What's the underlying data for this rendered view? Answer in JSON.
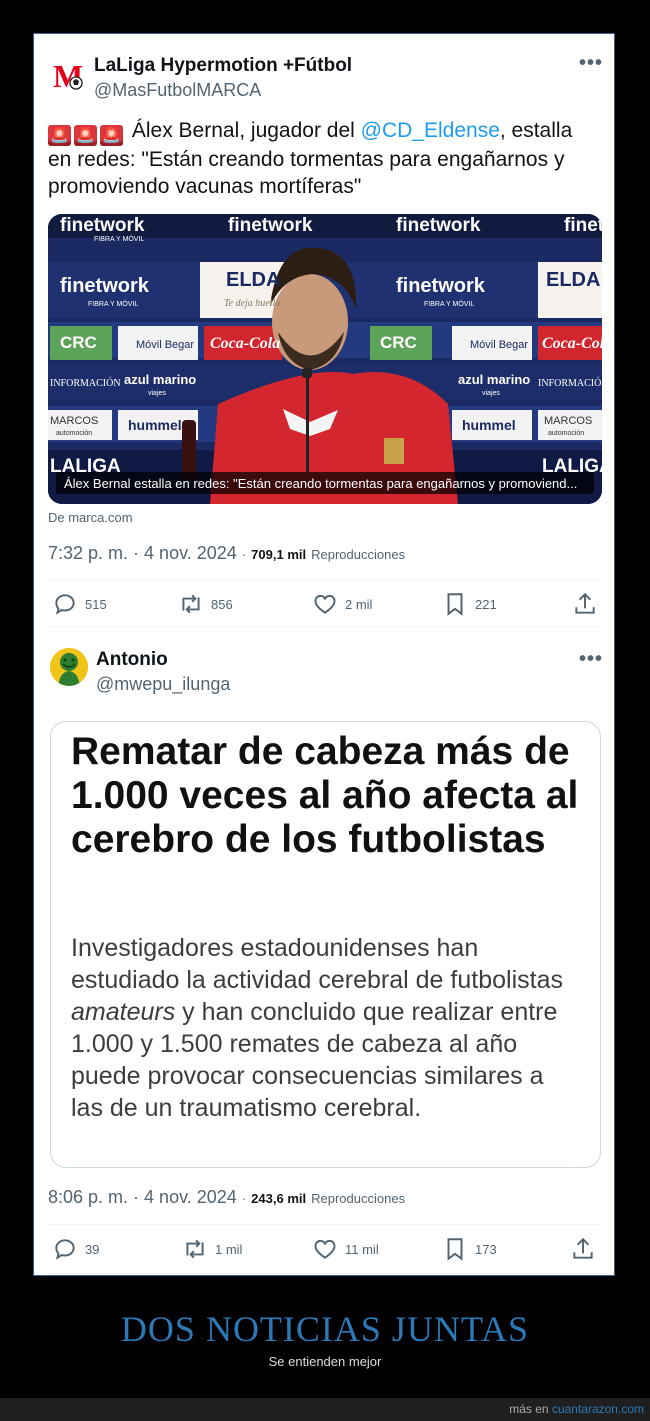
{
  "tweet1": {
    "name": "LaLiga Hypermotion +Fútbol",
    "handle": "@MasFutbolMARCA",
    "emoji_alerts": [
      "🚨",
      "🚨",
      "🚨"
    ],
    "text_part1": "Álex Bernal, jugador del ",
    "mention": "@CD_Eldense",
    "text_part2": ", estalla en redes: \"Están creando tormentas para engañarnos y promoviendo vacunas mortíferas\"",
    "media_caption": "Álex Bernal estalla en redes: \"Están creando tormentas para engañarnos y promoviend...",
    "media_source": "De marca.com",
    "sponsor_labels": [
      "finetwork",
      "FIBRA Y MÓVIL",
      "ELDA",
      "Te deja huella",
      "CRC",
      "Móvil Begar",
      "Coca-Cola",
      "INFORMACIÓN",
      "azul marino",
      "viajes",
      "MARCOS",
      "automoción",
      "hummel",
      "LALIGA"
    ],
    "time": "7:32 p. m.",
    "date": "4 nov. 2024",
    "views": "709,1 mil",
    "views_label": "Reproducciones",
    "replies": "515",
    "retweets": "856",
    "likes": "2 mil",
    "bookmarks": "221"
  },
  "tweet2": {
    "name": "Antonio",
    "handle": "@mwepu_ilunga",
    "article_title": "Rematar de cabeza más de 1.000 veces al año afecta al cerebro de los futbolistas",
    "article_desc_1": "Investigadores estadounidenses han estudiado la actividad cerebral de futbolistas ",
    "article_desc_italic": "amateurs",
    "article_desc_2": " y han concluido que realizar entre 1.000 y 1.500 remates de cabeza al año puede provocar consecuencias similares a las de un traumatismo cerebral.",
    "time": "8:06 p. m.",
    "date": "4 nov. 2024",
    "views": "243,6 mil",
    "views_label": "Reproducciones",
    "replies": "39",
    "retweets": "1 mil",
    "likes": "11 mil",
    "bookmarks": "173"
  },
  "more_glyph": "•••",
  "banner": {
    "title": "DOS NOTICIAS JUNTAS",
    "subtitle": "Se entienden mejor"
  },
  "footer": {
    "prefix": "más en",
    "site": "cuantarazon.com"
  },
  "colors": {
    "accent": "#1d9bf0",
    "banner_title": "#2b79b6",
    "alert_red": "#d9363e"
  }
}
